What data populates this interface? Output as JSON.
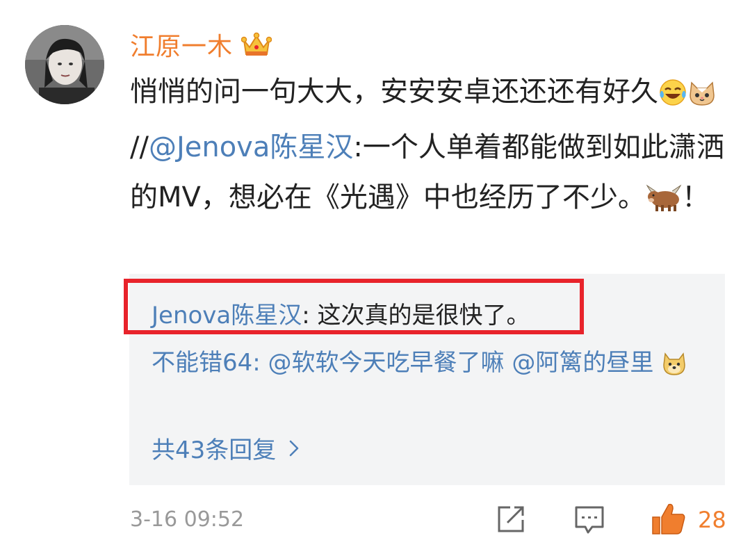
{
  "comment": {
    "username": "江原一木",
    "badge_icon": "crown-icon",
    "text_part1": "悄悄的问一句大大，安安安卓还还还有好久",
    "emoji_1": "laughing-tears-emoji",
    "emoji_2": "cat-emoji",
    "repost_sep": "//",
    "mention": "@Jenova陈星汉",
    "text_part2": ":一个人单着都能做到如此潇洒的MV，想必在《光遇》中也经历了不少。",
    "emoji_3": "ox-emoji",
    "text_part3": "！"
  },
  "replies": {
    "reply1_name": "Jenova陈星汉",
    "reply1_sep": ": ",
    "reply1_text": "这次真的是很快了。",
    "reply2_name": "不能错64",
    "reply2_text": ": @软软今天吃早餐了嘛 @阿篱的昼里",
    "reply2_emoji": "doge-emoji",
    "more_label": "共43条回复",
    "more_icon": "chevron-right-icon"
  },
  "footer": {
    "timestamp": "3-16 09:52",
    "share_icon": "share-icon",
    "comment_icon": "comment-icon",
    "like_icon": "thumbs-up-icon",
    "like_count": "28"
  },
  "colors": {
    "username": "#f07e2e",
    "link": "#4d7fb8",
    "highlight": "#e8232b",
    "reply_bg": "#f3f4f5"
  }
}
